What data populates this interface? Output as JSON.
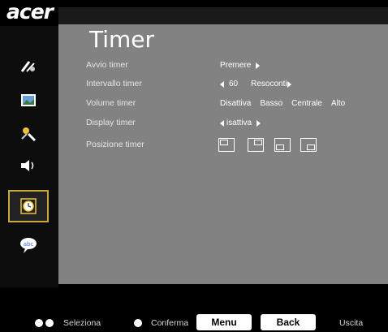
{
  "brand": {
    "logo": "acer"
  },
  "panel": {
    "title": "Timer",
    "rows": [
      {
        "label": "Avvio timer",
        "value": "Premere"
      },
      {
        "label": "Intervallo timer",
        "value": "60",
        "value2": "Resoconti"
      },
      {
        "label": "Volume timer",
        "options": [
          "Disattiva",
          "Basso",
          "Centrale",
          "Alto"
        ]
      },
      {
        "label": "Display timer",
        "value": "isattiva"
      },
      {
        "label": "Posizione timer",
        "positions": [
          "top-left",
          "top-right",
          "bottom-left",
          "bottom-right"
        ]
      }
    ]
  },
  "sidebar": {
    "items": [
      {
        "icon": "management-icon"
      },
      {
        "icon": "image-icon"
      },
      {
        "icon": "settings-icon"
      },
      {
        "icon": "audio-icon"
      },
      {
        "icon": "timer-icon",
        "active": true
      },
      {
        "icon": "language-icon"
      }
    ]
  },
  "footer": {
    "select_label": "Seleziona",
    "confirm_label": "Conferma",
    "menu_label": "Menu",
    "back_label": "Back",
    "exit_label": "Uscita"
  },
  "colors": {
    "panel": "#828282",
    "accent": "#c9a83a"
  }
}
